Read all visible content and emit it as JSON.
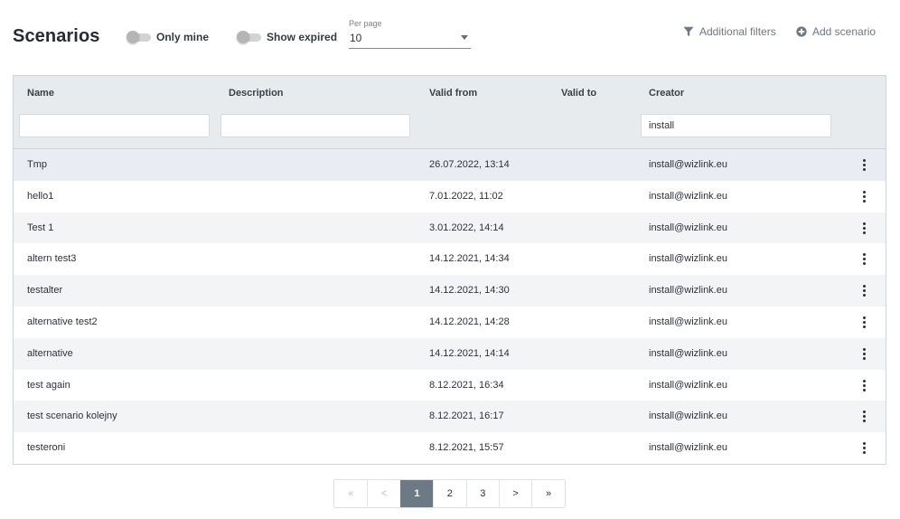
{
  "header": {
    "title": "Scenarios",
    "toggle_only_mine": "Only mine",
    "toggle_show_expired": "Show expired",
    "per_page_caption": "Per page",
    "per_page_value": "10",
    "additional_filters": "Additional filters",
    "add_scenario": "Add scenario"
  },
  "table": {
    "columns": {
      "name": "Name",
      "description": "Description",
      "valid_from": "Valid from",
      "valid_to": "Valid to",
      "creator": "Creator"
    },
    "filters": {
      "name": "",
      "description": "",
      "creator": "install"
    },
    "rows": [
      {
        "name": "Tmp",
        "description": "",
        "valid_from": "26.07.2022, 13:14",
        "valid_to": "",
        "creator": "install@wizlink.eu"
      },
      {
        "name": "hello1",
        "description": "",
        "valid_from": "7.01.2022, 11:02",
        "valid_to": "",
        "creator": "install@wizlink.eu"
      },
      {
        "name": "Test 1",
        "description": "",
        "valid_from": "3.01.2022, 14:14",
        "valid_to": "",
        "creator": "install@wizlink.eu"
      },
      {
        "name": "altern test3",
        "description": "",
        "valid_from": "14.12.2021, 14:34",
        "valid_to": "",
        "creator": "install@wizlink.eu"
      },
      {
        "name": "testalter",
        "description": "",
        "valid_from": "14.12.2021, 14:30",
        "valid_to": "",
        "creator": "install@wizlink.eu"
      },
      {
        "name": "alternative test2",
        "description": "",
        "valid_from": "14.12.2021, 14:28",
        "valid_to": "",
        "creator": "install@wizlink.eu"
      },
      {
        "name": "alternative",
        "description": "",
        "valid_from": "14.12.2021, 14:14",
        "valid_to": "",
        "creator": "install@wizlink.eu"
      },
      {
        "name": "test again",
        "description": "",
        "valid_from": "8.12.2021, 16:34",
        "valid_to": "",
        "creator": "install@wizlink.eu"
      },
      {
        "name": "test scenario kolejny",
        "description": "",
        "valid_from": "8.12.2021, 16:17",
        "valid_to": "",
        "creator": "install@wizlink.eu"
      },
      {
        "name": "testeroni",
        "description": "",
        "valid_from": "8.12.2021, 15:57",
        "valid_to": "",
        "creator": "install@wizlink.eu"
      }
    ]
  },
  "pagination": {
    "first": "«",
    "prev": "<",
    "pages": [
      "1",
      "2",
      "3"
    ],
    "current": "1",
    "next": ">",
    "last": "»"
  },
  "icons": {
    "filter": "filter-icon",
    "add": "plus-circle-icon",
    "row_menu": "kebab-menu-icon"
  },
  "colors": {
    "header_bg": "#e8ebed",
    "active_page": "#6c7a87",
    "toggle_off": "#b5b5b5"
  }
}
